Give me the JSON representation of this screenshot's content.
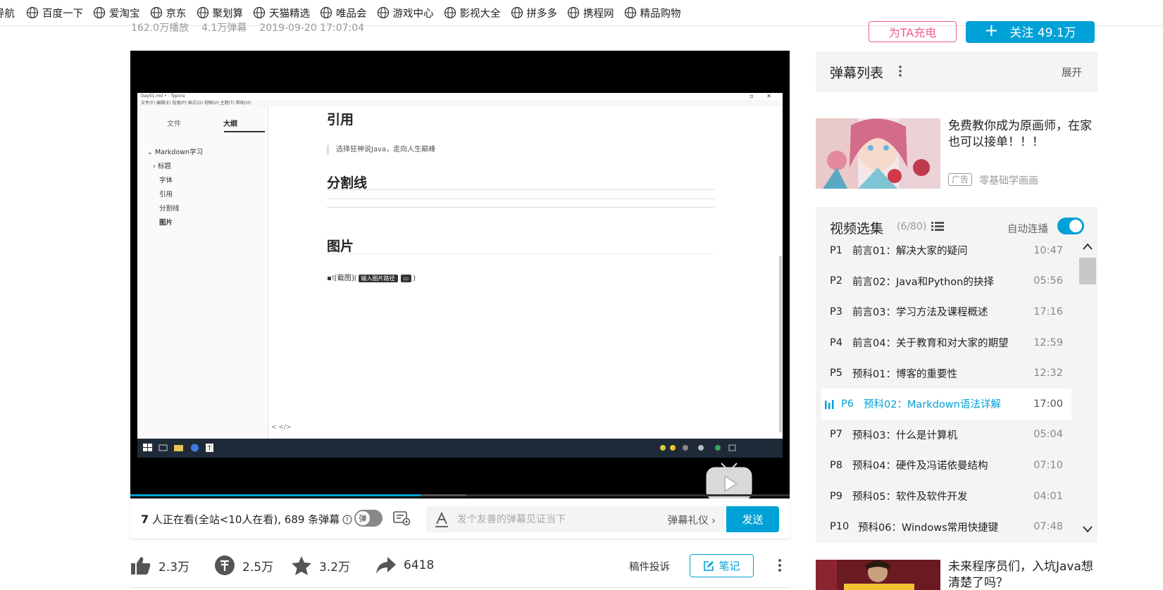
{
  "bookmarks": [
    {
      "label": "导航"
    },
    {
      "label": "百度一下"
    },
    {
      "label": "爱淘宝"
    },
    {
      "label": "京东"
    },
    {
      "label": "聚划算"
    },
    {
      "label": "天猫精选"
    },
    {
      "label": "唯品会"
    },
    {
      "label": "游戏中心"
    },
    {
      "label": "影视大全"
    },
    {
      "label": "拼多多"
    },
    {
      "label": "携程网"
    },
    {
      "label": "精品购物"
    }
  ],
  "meta": {
    "plays": "162.0万播放",
    "danmaku": "4.1万弹幕",
    "date": "2019-09-20 17:07:04"
  },
  "uploader": {
    "charge_label": "为TA充电",
    "follow_label": "关注 49.1万"
  },
  "video_frame": {
    "window_title": "Day01.md • - Typora",
    "menu": "文件(F)  编辑(E)  段落(P)  格式(O)  视图(V)  主题(T)  帮助(H)",
    "sidebar_tab_files": "文件",
    "sidebar_tab_outline": "大纲",
    "outline": [
      "Markdown学习",
      "标题",
      "字体",
      "引用",
      "分割线",
      "图片"
    ],
    "heading_quote": "引用",
    "quote_text": "选择狂神说Java，走向人生巅峰",
    "heading_hr": "分割线",
    "heading_image": "图片",
    "image_syntax_prefix": "![截图](",
    "image_tooltip": "输入图片路径",
    "image_syntax_suffix": ")",
    "bottom_controls": "<  </>"
  },
  "player": {
    "progress_played": 0.44,
    "progress_buffered": 0.51
  },
  "sendbar": {
    "viewers_count": "7",
    "viewers_text": " 人正在看(全站<10人在看), 689 条弹幕",
    "danmu_toggle_label": "弹",
    "input_placeholder": "发个友善的弹幕见证当下",
    "etiquette_label": "弹幕礼仪 ›",
    "send_label": "发送"
  },
  "actions": {
    "like": "2.3万",
    "coin": "2.5万",
    "favorite": "3.2万",
    "share": "6418",
    "report": "稿件投诉",
    "note": "笔记"
  },
  "danmu_list": {
    "title": "弹幕列表",
    "expand": "展开"
  },
  "ad": {
    "title": "免费教你成为原画师，在家也可以接单！！！",
    "badge": "广告",
    "source": "零基础学画画"
  },
  "playlist": {
    "title": "视频选集",
    "count": "(6/80)",
    "autoplay_label": "自动连播",
    "items": [
      {
        "p": "P1",
        "title": "前言01：解决大家的疑问",
        "duration": "10:47"
      },
      {
        "p": "P2",
        "title": "前言02：Java和Python的抉择",
        "duration": "05:56"
      },
      {
        "p": "P3",
        "title": "前言03：学习方法及课程概述",
        "duration": "17:16"
      },
      {
        "p": "P4",
        "title": "前言04：关于教育和对大家的期望",
        "duration": "12:59"
      },
      {
        "p": "P5",
        "title": "预科01：博客的重要性",
        "duration": "12:32"
      },
      {
        "p": "P6",
        "title": "预科02：Markdown语法详解",
        "duration": "17:00"
      },
      {
        "p": "P7",
        "title": "预科03：什么是计算机",
        "duration": "05:04"
      },
      {
        "p": "P8",
        "title": "预科04：硬件及冯诺依曼结构",
        "duration": "07:10"
      },
      {
        "p": "P9",
        "title": "预科05：软件及软件开发",
        "duration": "04:01"
      },
      {
        "p": "P10",
        "title": "预科06：Windows常用快捷键",
        "duration": "07:48"
      }
    ]
  },
  "recommend": {
    "title": "未来程序员们，入坑Java想清楚了吗？"
  },
  "colors": {
    "accent": "#00a1d6",
    "pink": "#f25d8e"
  }
}
